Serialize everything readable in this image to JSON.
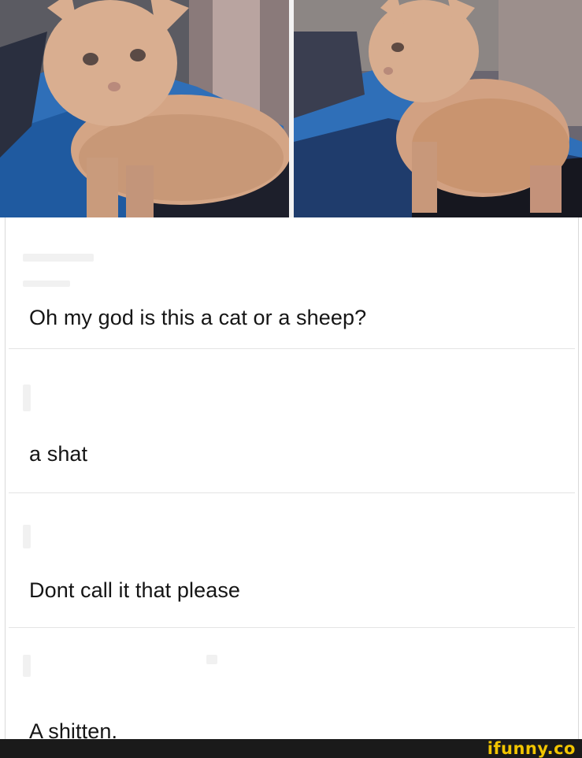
{
  "post": {
    "images": [
      {
        "subject": "curly-furred kitten on blue blanket"
      },
      {
        "subject": "curly-furred kitten side view on blanket"
      }
    ]
  },
  "comments": [
    {
      "text": "Oh my god is this a cat or a sheep?"
    },
    {
      "text": "a shat"
    },
    {
      "text": "Dont call it that please"
    },
    {
      "text": "A shitten."
    }
  ],
  "watermark": {
    "text": "ifunny.co",
    "color": "#f2c500"
  },
  "colors": {
    "background": "#ffffff",
    "text": "#151515",
    "bar": "#1a1a1a"
  }
}
